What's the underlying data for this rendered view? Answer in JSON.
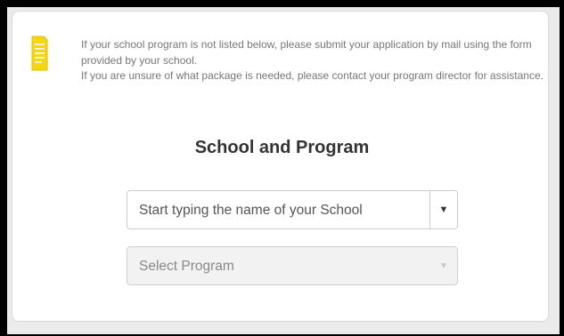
{
  "notice": {
    "line1": "If your school program is not listed below, please submit your application by mail using the form provided by your school.",
    "line2": "If you are unsure of what package is needed, please contact your program director for assistance."
  },
  "section": {
    "title": "School and Program"
  },
  "school_select": {
    "placeholder": "Start typing the name of your School",
    "icon": "triangle-down"
  },
  "program_select": {
    "placeholder": "Select Program",
    "icon": "triangle-down",
    "disabled": true
  },
  "colors": {
    "note_icon": "#f5d614",
    "page_bg": "#ebebeb",
    "card_bg": "#ffffff"
  }
}
